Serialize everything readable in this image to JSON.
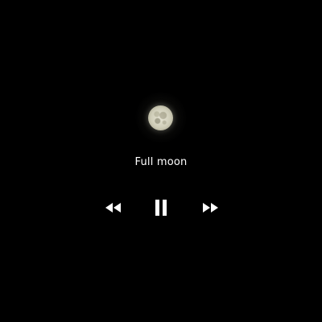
{
  "player": {
    "title": "Full moon",
    "state": "playing",
    "colors": {
      "background": "#000000",
      "foreground": "#ffffff"
    },
    "artwork": {
      "subject": "moon"
    },
    "controls": {
      "rewind_icon": "rewind-icon",
      "pause_icon": "pause-icon",
      "fast_forward_icon": "fast-forward-icon"
    }
  }
}
